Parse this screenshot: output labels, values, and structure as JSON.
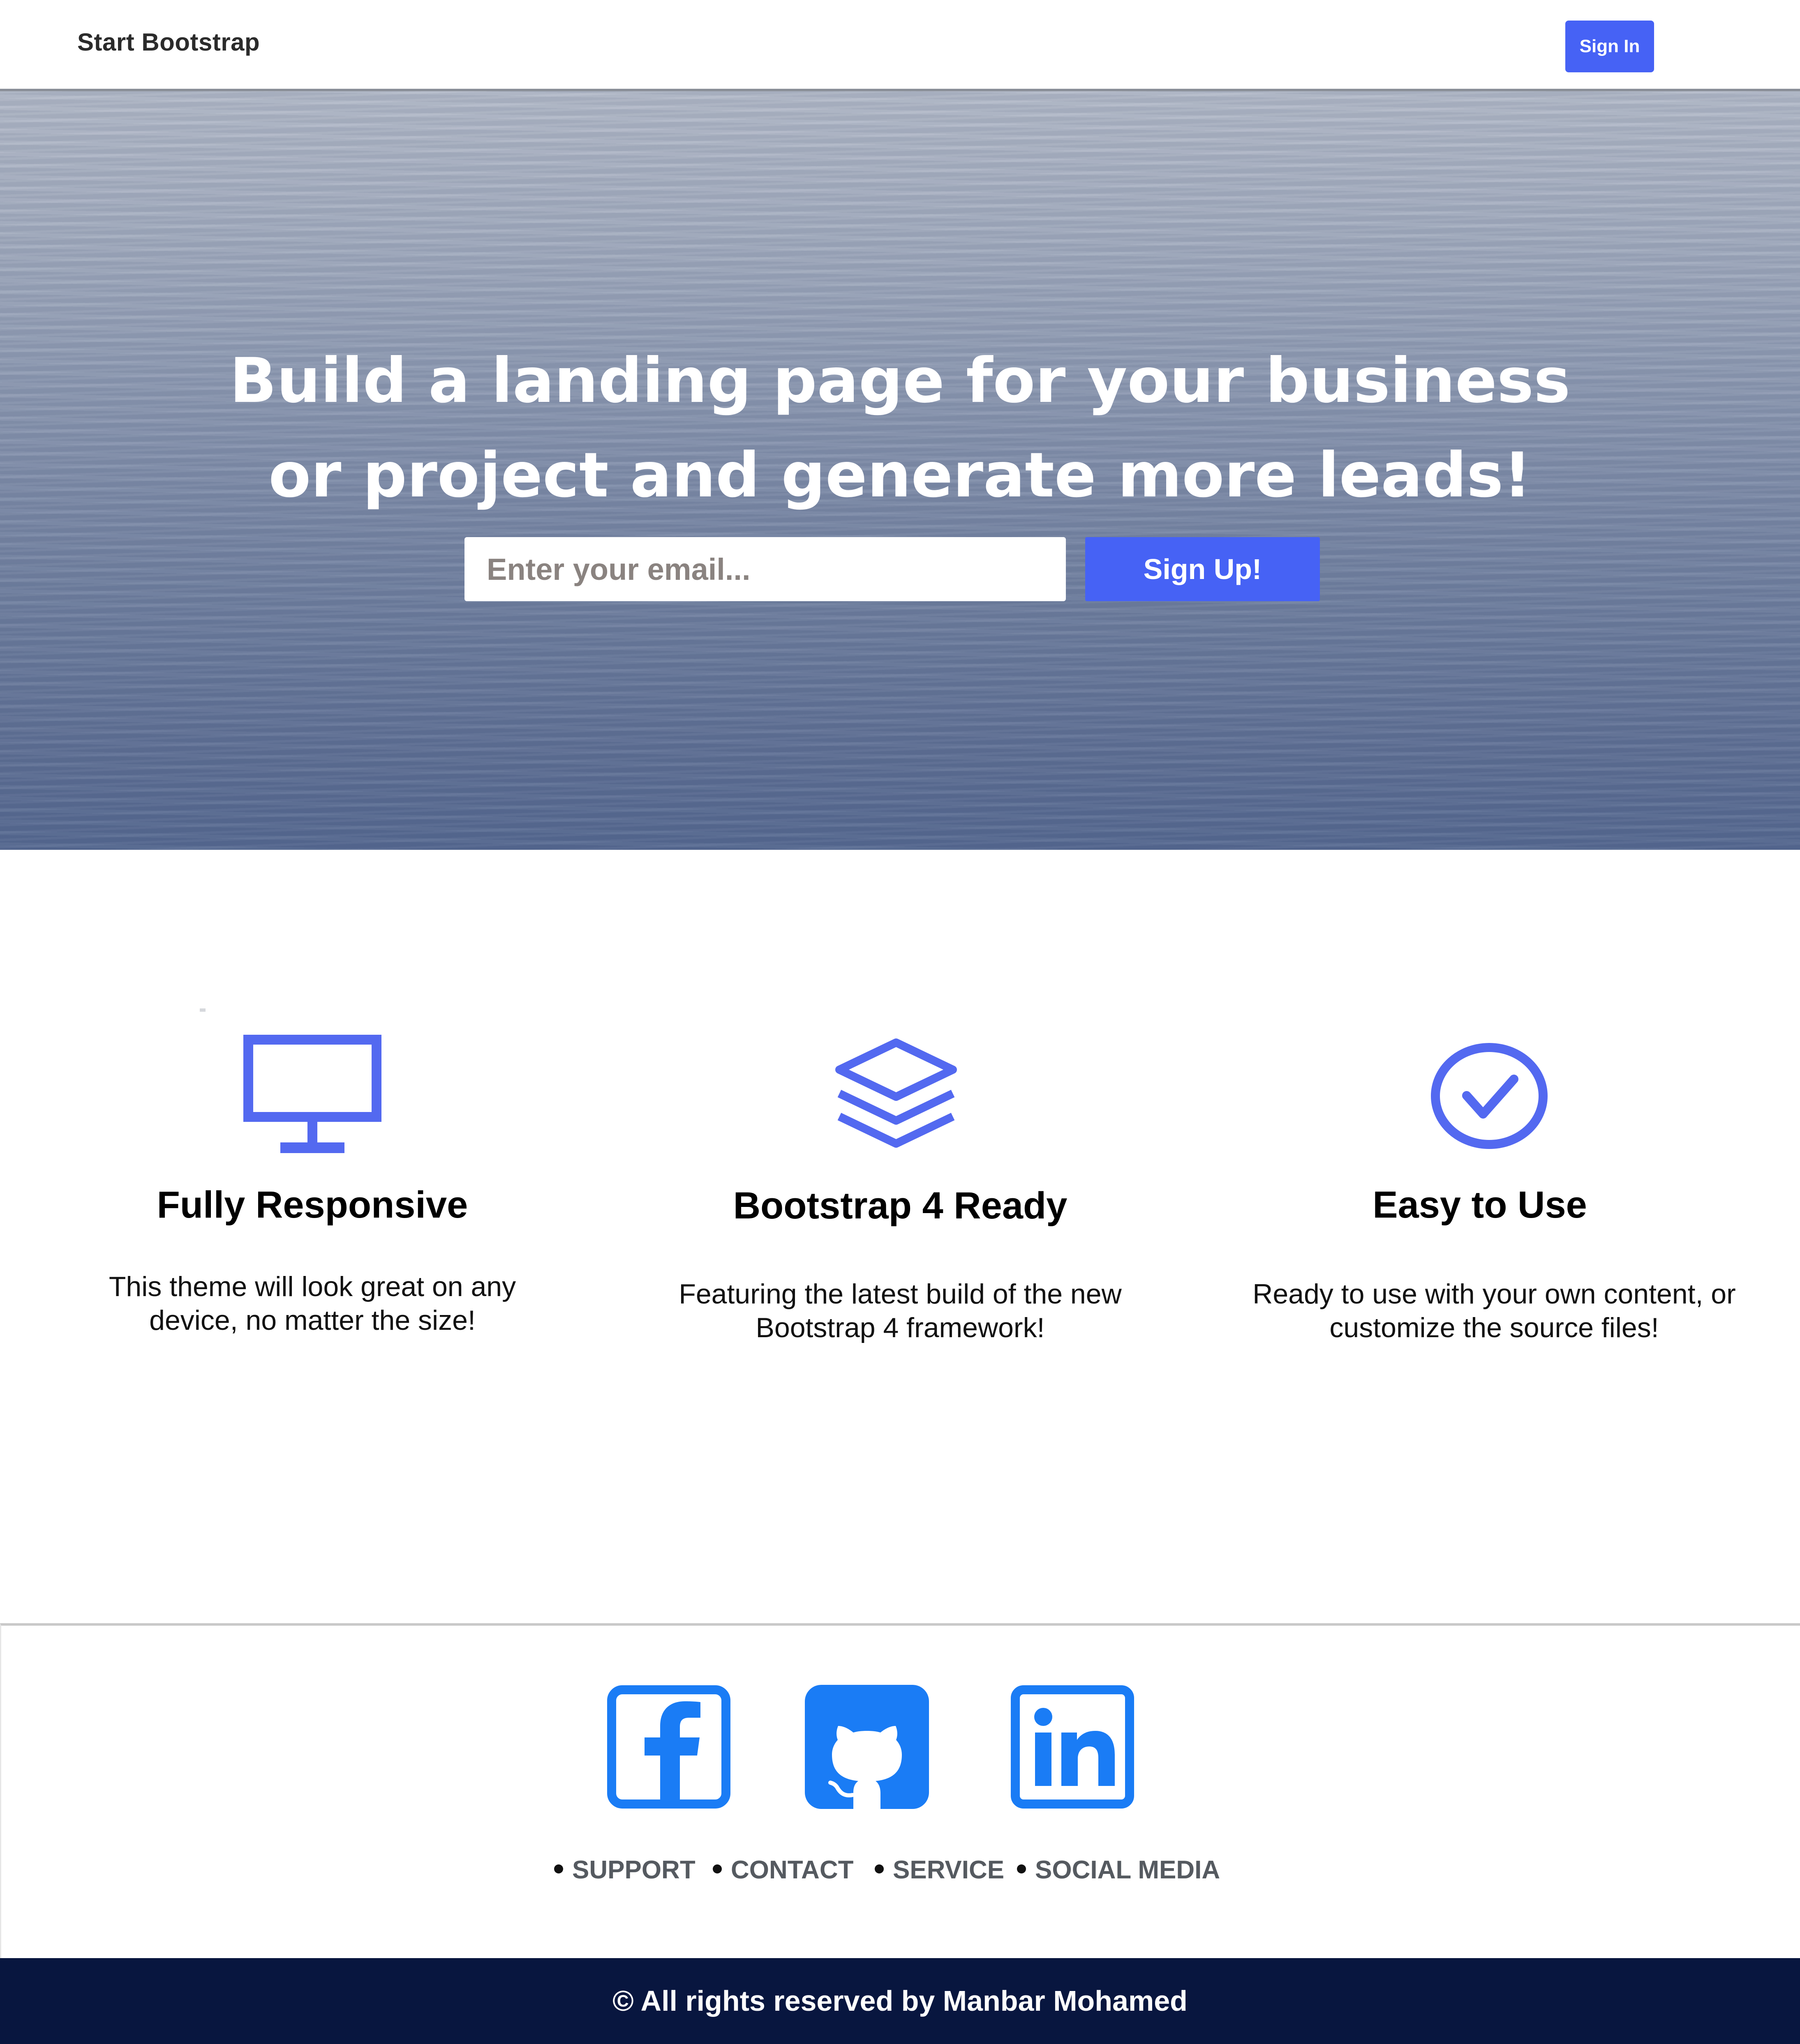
{
  "navbar": {
    "brand": "Start Bootstrap",
    "signin_label": "Sign In"
  },
  "hero": {
    "title_line1": "Build a landing page for your business",
    "title_line2": "or project and generate more leads!",
    "email_placeholder": "Enter your email...",
    "signup_label": "Sign Up!"
  },
  "features": [
    {
      "icon": "monitor-icon",
      "title": "Fully Responsive",
      "desc_line1": "This theme will look great on any",
      "desc_line2": "device, no matter the size!"
    },
    {
      "icon": "layers-icon",
      "title": "Bootstrap 4 Ready",
      "desc_line1": "Featuring the latest build of the new",
      "desc_line2": "Bootstrap 4 framework!"
    },
    {
      "icon": "check-circle-icon",
      "title": "Easy to Use",
      "desc_line1": "Ready to use with your own content, or",
      "desc_line2": "customize the source files!"
    }
  ],
  "social": [
    {
      "icon": "facebook-icon"
    },
    {
      "icon": "github-icon"
    },
    {
      "icon": "linkedin-icon"
    }
  ],
  "footer_links": [
    "SUPPORT",
    "CONTACT",
    "SERVICE",
    "SOCIAL MEDIA"
  ],
  "copyright": "© All rights reserved by Manbar Mohamed",
  "colors": {
    "primary": "#4662f5",
    "feature_icon": "#5369f0",
    "social_icon": "#1a7cf5",
    "footer_bar": "#08163f"
  }
}
